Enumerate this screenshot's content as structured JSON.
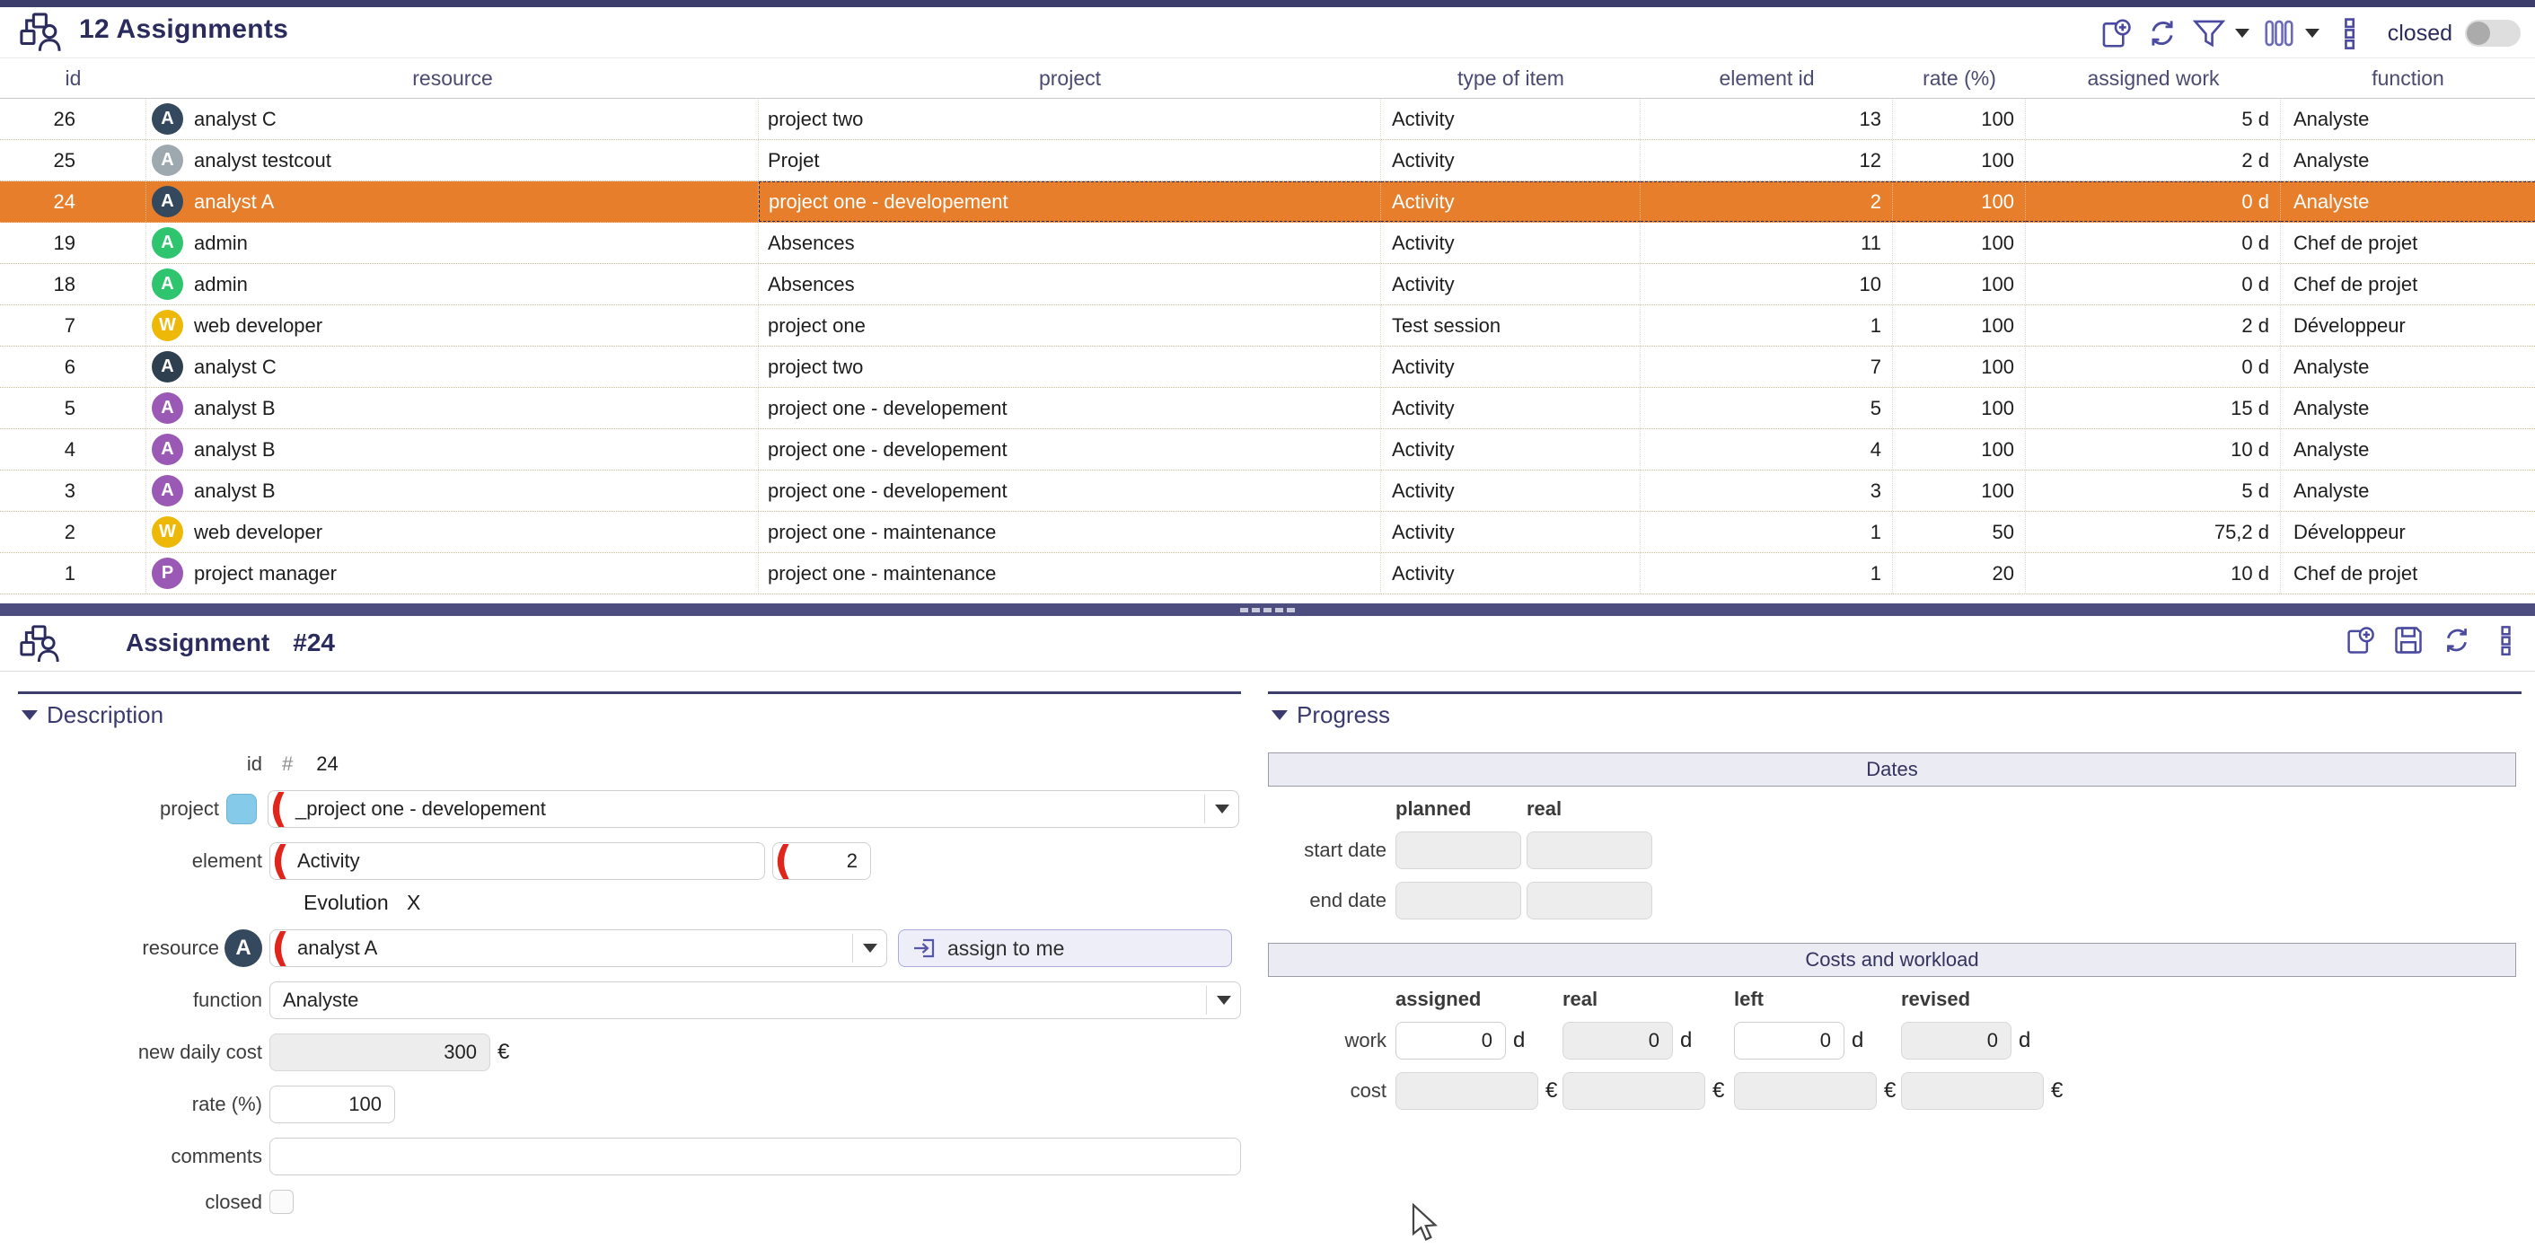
{
  "list_panel": {
    "title": "12 Assignments",
    "toolbar": {
      "icons": [
        "add-icon",
        "refresh-icon",
        "filter-icon",
        "columns-icon",
        "kebab-icon"
      ],
      "closed_label": "closed",
      "closed_toggle_state": "off"
    },
    "columns": [
      "id",
      "resource",
      "project",
      "type of item",
      "element id",
      "rate (%)",
      "assigned work",
      "function"
    ],
    "selected_row_color": "#E67E2B",
    "rows": [
      {
        "id": "26",
        "avatar": "A",
        "avatar_color": "#34495E",
        "resource": "analyst C",
        "project": "project two",
        "type": "Activity",
        "element_id": "13",
        "rate": "100",
        "work": "5 d",
        "function": "Analyste",
        "selected": false
      },
      {
        "id": "25",
        "avatar": "A",
        "avatar_color": "#9DA9AE",
        "resource": "analyst testcout",
        "project": "Projet",
        "type": "Activity",
        "element_id": "12",
        "rate": "100",
        "work": "2 d",
        "function": "Analyste",
        "selected": false
      },
      {
        "id": "24",
        "avatar": "A",
        "avatar_color": "#34495E",
        "resource": "analyst A",
        "project": "project one - developement",
        "type": "Activity",
        "element_id": "2",
        "rate": "100",
        "work": "0 d",
        "function": "Analyste",
        "selected": true
      },
      {
        "id": "19",
        "avatar": "A",
        "avatar_color": "#2FC56F",
        "resource": "admin",
        "project": "Absences",
        "type": "Activity",
        "element_id": "11",
        "rate": "100",
        "work": "0 d",
        "function": "Chef de projet",
        "selected": false
      },
      {
        "id": "18",
        "avatar": "A",
        "avatar_color": "#2FC56F",
        "resource": "admin",
        "project": "Absences",
        "type": "Activity",
        "element_id": "10",
        "rate": "100",
        "work": "0 d",
        "function": "Chef de projet",
        "selected": false
      },
      {
        "id": "7",
        "avatar": "W",
        "avatar_color": "#EDB807",
        "resource": "web developer",
        "project": "project one",
        "type": "Test session",
        "element_id": "1",
        "rate": "100",
        "work": "2 d",
        "function": "Développeur",
        "selected": false
      },
      {
        "id": "6",
        "avatar": "A",
        "avatar_color": "#2E3F50",
        "resource": "analyst C",
        "project": "project two",
        "type": "Activity",
        "element_id": "7",
        "rate": "100",
        "work": "0 d",
        "function": "Analyste",
        "selected": false
      },
      {
        "id": "5",
        "avatar": "A",
        "avatar_color": "#9B59B6",
        "resource": "analyst B",
        "project": "project one - developement",
        "type": "Activity",
        "element_id": "5",
        "rate": "100",
        "work": "15 d",
        "function": "Analyste",
        "selected": false
      },
      {
        "id": "4",
        "avatar": "A",
        "avatar_color": "#9B59B6",
        "resource": "analyst B",
        "project": "project one - developement",
        "type": "Activity",
        "element_id": "4",
        "rate": "100",
        "work": "10 d",
        "function": "Analyste",
        "selected": false
      },
      {
        "id": "3",
        "avatar": "A",
        "avatar_color": "#9B59B6",
        "resource": "analyst B",
        "project": "project one - developement",
        "type": "Activity",
        "element_id": "3",
        "rate": "100",
        "work": "5 d",
        "function": "Analyste",
        "selected": false
      },
      {
        "id": "2",
        "avatar": "W",
        "avatar_color": "#EDB807",
        "resource": "web developer",
        "project": "project one - maintenance",
        "type": "Activity",
        "element_id": "1",
        "rate": "50",
        "work": "75,2 d",
        "function": "Développeur",
        "selected": false
      },
      {
        "id": "1",
        "avatar": "P",
        "avatar_color": "#9B59B6",
        "resource": "project manager",
        "project": "project one - maintenance",
        "type": "Activity",
        "element_id": "1",
        "rate": "20",
        "work": "10 d",
        "function": "Chef de projet",
        "selected": false
      }
    ]
  },
  "detail_panel": {
    "title_label": "Assignment",
    "title_number": "#24",
    "toolbar": {
      "icons": [
        "add-icon",
        "save-icon",
        "refresh-icon",
        "kebab-icon"
      ]
    },
    "description": {
      "section_title": "Description",
      "id_label": "id",
      "id_hash": "#",
      "id_value": "24",
      "project_label": "project",
      "project_color": "#85CBE9",
      "project_value": "_project one - developement",
      "element_label": "element",
      "element_value": "Activity",
      "element_id_value": "2",
      "element_link": "Evolution",
      "element_clear": "X",
      "resource_label": "resource",
      "resource_avatar": "A",
      "resource_avatar_color": "#34495E",
      "resource_value": "analyst A",
      "assign_to_me_label": "assign to me",
      "function_label": "function",
      "function_value": "Analyste",
      "daily_cost_label": "new daily cost",
      "daily_cost_value": "300",
      "euro": "€",
      "rate_label": "rate (%)",
      "rate_value": "100",
      "comments_label": "comments",
      "comments_value": "",
      "closed_label": "closed",
      "closed_checked": false
    },
    "progress": {
      "section_title": "Progress",
      "dates_header": "Dates",
      "col_planned": "planned",
      "col_real": "real",
      "start_date_label": "start date",
      "end_date_label": "end date",
      "costs_header": "Costs and workload",
      "cols": [
        "assigned",
        "real",
        "left",
        "revised"
      ],
      "work_label": "work",
      "work_values": [
        "0",
        "0",
        "0",
        "0"
      ],
      "work_unit": "d",
      "cost_label": "cost",
      "cost_values": [
        "",
        "",
        "",
        ""
      ],
      "cost_unit": "€"
    }
  }
}
